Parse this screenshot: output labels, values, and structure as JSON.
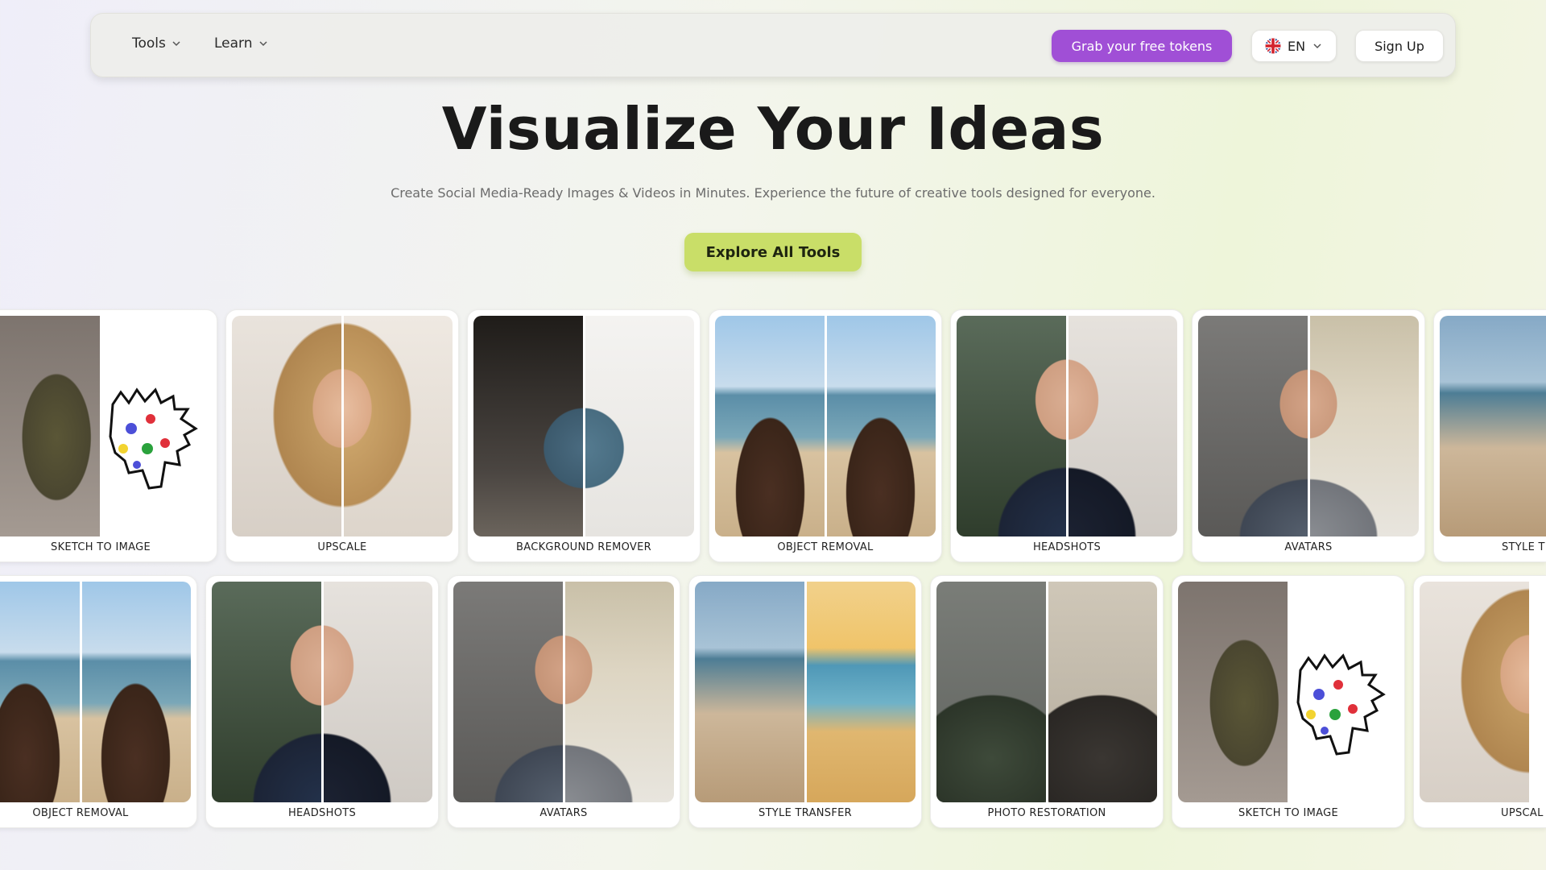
{
  "nav": {
    "tools_label": "Tools",
    "learn_label": "Learn",
    "tokens_label": "Grab your free tokens",
    "lang_label": "EN",
    "signup_label": "Sign Up"
  },
  "hero": {
    "title": "Visualize Your Ideas",
    "subtitle": "Create Social Media-Ready Images & Videos in Minutes. Experience the future of creative tools designed for everyone.",
    "cta_label": "Explore All Tools"
  },
  "colors": {
    "accent_purple": "#a04fd6",
    "accent_lime": "#c9de68"
  },
  "row1": [
    {
      "label": "SKETCH TO IMAGE"
    },
    {
      "label": "UPSCALE"
    },
    {
      "label": "BACKGROUND REMOVER"
    },
    {
      "label": "OBJECT REMOVAL"
    },
    {
      "label": "HEADSHOTS"
    },
    {
      "label": "AVATARS"
    },
    {
      "label": "STYLE T"
    }
  ],
  "row2": [
    {
      "label": "OBJECT REMOVAL"
    },
    {
      "label": "HEADSHOTS"
    },
    {
      "label": "AVATARS"
    },
    {
      "label": "STYLE TRANSFER"
    },
    {
      "label": "PHOTO RESTORATION"
    },
    {
      "label": "SKETCH TO IMAGE"
    },
    {
      "label": "UPSCAL"
    }
  ]
}
